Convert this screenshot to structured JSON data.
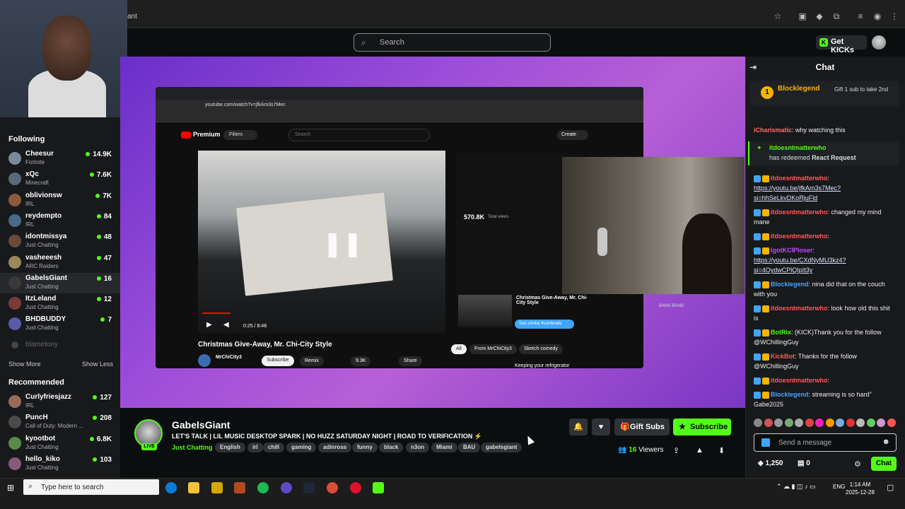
{
  "browser": {
    "tab_title": "ant"
  },
  "header": {
    "search_placeholder": "Search",
    "get_kicks": "Get KICKs"
  },
  "sidebar": {
    "following_label": "Following",
    "following": [
      {
        "name": "Cheesur",
        "category": "Fortnite",
        "viewers": "14.9K",
        "color": "#7a8a9a"
      },
      {
        "name": "xQc",
        "category": "Minecraft",
        "viewers": "7.6K",
        "color": "#5a6a7a"
      },
      {
        "name": "oblivionsw",
        "category": "IRL",
        "viewers": "7K",
        "color": "#8a5a3a"
      },
      {
        "name": "reydempto",
        "category": "IRL",
        "viewers": "84",
        "color": "#4a6a8a"
      },
      {
        "name": "idontmissya",
        "category": "Just Chatting",
        "viewers": "48",
        "color": "#6a4a3a"
      },
      {
        "name": "vasheeesh",
        "category": "ARC Raiders",
        "viewers": "47",
        "color": "#9a8a5a"
      },
      {
        "name": "GabelsGiant",
        "category": "Just Chatting",
        "viewers": "16",
        "color": "#3a3a3a"
      },
      {
        "name": "ItzLeland",
        "category": "Just Chatting",
        "viewers": "12",
        "color": "#7a3a3a"
      },
      {
        "name": "BHDBUDDY",
        "category": "Just Chatting",
        "viewers": "7",
        "color": "#5a5aaa"
      }
    ],
    "offline": "blametony",
    "show_more": "Show More",
    "show_less": "Show Less",
    "recommended_label": "Recommended",
    "recommended": [
      {
        "name": "Curlyfriesjazz",
        "category": "IRL",
        "viewers": "127",
        "color": "#9a6a5a"
      },
      {
        "name": "PuncH",
        "category": "Call of Duty: Modern ...",
        "viewers": "208",
        "color": "#4a4a4a"
      },
      {
        "name": "kyootbot",
        "category": "Just Chatting",
        "viewers": "6.8K",
        "color": "#5a8a4a"
      },
      {
        "name": "hello_kiko",
        "category": "Just Chatting",
        "viewers": "103",
        "color": "#8a5a7a"
      }
    ]
  },
  "video": {
    "yt_url": "youtube.com/watch?v=jfkAm3s7Mec",
    "yt_premium": "Premium",
    "yt_filters": "Filters",
    "yt_search": "Search",
    "yt_create": "Create",
    "time": "0:25 / 8:48",
    "yt_video_title": "Christmas Give-Away, Mr. Chi-City Style",
    "channel": "MrChiCity3",
    "subscribe": "Subscribe",
    "remix": "Remix",
    "likes": "9.3K",
    "share": "Share",
    "analytics_views": "570.8K",
    "analytics_total": "Total views",
    "related_title": "Christmas Give-Away, Mr. Chi-City Style",
    "similar": "See similar thumbnails",
    "chips": [
      "All",
      "From MrChiCity3",
      "Sketch comedy"
    ],
    "keep": "Keeping your refrigerator",
    "bangbang": "BANG BANG"
  },
  "stream": {
    "name": "GabelsGiant",
    "title": "LET'S TALK | LIL MUSIC DESKTOP SPARK | NO HUZZ SATURDAY NIGHT | ROAD TO VERIFICATION ⚡",
    "category": "Just Chatting",
    "tags": [
      "English",
      "irl",
      "chill",
      "gaming",
      "adinross",
      "funny",
      "black",
      "n3on",
      "Miami",
      "BAU",
      "gabelsgiant"
    ],
    "live": "LIVE",
    "gift_subs": "Gift Subs",
    "subscribe": "Subscribe",
    "viewers": "16",
    "viewers_label": "Viewers"
  },
  "chat": {
    "title": "Chat",
    "pinned_user": "Blocklegend",
    "pinned_text": "Gift 1 sub to take 2nd",
    "messages": [
      {
        "user": "iCharismatic",
        "text": "why watching this",
        "color": "#ff6b6b"
      },
      {
        "user": "itdoesntmatterwho",
        "text": "https://youtu.be/jfkAm3s7Mec?si=hhSeLkvDKoRjuFld",
        "color": "#ff5a5a"
      },
      {
        "user": "itdoesntmatterwho",
        "text": "changed my mind mane",
        "color": "#ff5a5a"
      },
      {
        "user": "itdoesntmatterwho",
        "text": "",
        "color": "#ff5a5a"
      },
      {
        "user": "IgotKClPloser",
        "text": "https://youtu.be/CXdNyMU3kz4?si=4OydwCPlQIpIt3y",
        "color": "#c04bff"
      },
      {
        "user": "Blocklegend",
        "text": "nina did that on the couch with you",
        "color": "#4aa3ff"
      },
      {
        "user": "itdoesntmatterwho",
        "text": "look how old this shit is",
        "color": "#ff5a5a"
      },
      {
        "user": "BotRix",
        "text": "(KICK)Thank you for the follow @WChillingGuy",
        "color": "#53fc18"
      },
      {
        "user": "KickBot",
        "text": "Thanks for the follow @WChillingGuy",
        "color": "#ff5a5a"
      },
      {
        "user": "itdoesntmatterwho",
        "text": "",
        "color": "#ff5a5a"
      },
      {
        "user": "Blocklegend",
        "text": "streaming is so hard\" Gabe2025",
        "color": "#4aa3ff"
      }
    ],
    "redeem_user": "itdoesntmatterwho",
    "redeem_text": "has redeemed",
    "redeem_item": "React Request",
    "input_placeholder": "Send a message",
    "points": "1,250",
    "points2": "0",
    "send": "Chat"
  },
  "taskbar": {
    "search": "Type here to search",
    "lang": "ENG",
    "time": "1:14 AM",
    "date": "2025-12-28"
  }
}
